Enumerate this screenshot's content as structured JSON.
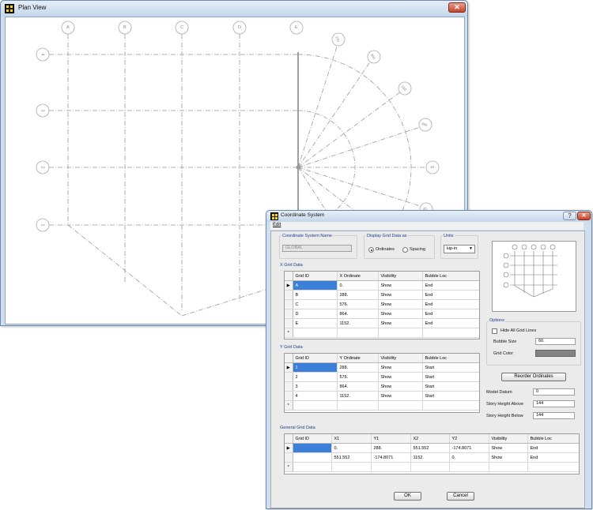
{
  "plan_window": {
    "title": "Plan View",
    "close_label": "✕",
    "x_bubbles": [
      "A",
      "B",
      "C",
      "D",
      "E"
    ],
    "y_bubbles": [
      "4",
      "3",
      "2",
      "1"
    ],
    "radial_bubbles": [
      "270",
      "300",
      "330",
      "360",
      "15",
      "45"
    ]
  },
  "dialog": {
    "title": "Coordinate System",
    "help_label": "?",
    "close_label": "✕",
    "menu": {
      "edit": "Edit"
    },
    "coord_system": {
      "label": "Coordinate System Name",
      "value": "GLOBAL"
    },
    "display_grid": {
      "label": "Display Grid Data as",
      "ordinates_label": "Ordinates",
      "spacing_label": "Spacing",
      "selected": "Ordinates"
    },
    "units": {
      "label": "Units",
      "value": "kip-in"
    },
    "x_grid": {
      "label": "X Grid Data",
      "columns": [
        "Grid ID",
        "X Ordinate",
        "Visibility",
        "Bubble Loc"
      ],
      "rows": [
        [
          "A",
          "0.",
          "Show",
          "End"
        ],
        [
          "B",
          "288.",
          "Show",
          "End"
        ],
        [
          "C",
          "576.",
          "Show",
          "End"
        ],
        [
          "D",
          "864.",
          "Show",
          "End"
        ],
        [
          "E",
          "1152.",
          "Show",
          "End"
        ]
      ]
    },
    "y_grid": {
      "label": "Y Grid Data",
      "columns": [
        "Grid ID",
        "Y Ordinate",
        "Visibility",
        "Bubble Loc"
      ],
      "rows": [
        [
          "1",
          "288.",
          "Show",
          "Start"
        ],
        [
          "2",
          "576.",
          "Show",
          "Start"
        ],
        [
          "3",
          "864.",
          "Show",
          "Start"
        ],
        [
          "4",
          "1152.",
          "Show",
          "Start"
        ]
      ]
    },
    "general_grid": {
      "label": "General Grid Data",
      "columns": [
        "Grid ID",
        "X1",
        "Y1",
        "X2",
        "Y2",
        "Visibility",
        "Bubble Loc"
      ],
      "rows": [
        [
          "",
          "0.",
          "288.",
          "551.552",
          "-174.8071",
          "Show",
          "End"
        ],
        [
          "",
          "551.552",
          "-174.8071",
          "1152.",
          "0.",
          "Show",
          "End"
        ]
      ]
    },
    "options": {
      "label": "Options",
      "hide_all_label": "Hide All Grid Lines",
      "bubble_size_label": "Bubble Size",
      "bubble_size_value": "60.",
      "grid_color_label": "Grid Color",
      "grid_color": "#828282"
    },
    "reorder_label": "Reorder Ordinates",
    "model_datum": {
      "label": "Model Datum",
      "value": "0"
    },
    "story_above": {
      "label": "Story Height Above",
      "value": "144"
    },
    "story_below": {
      "label": "Story Height Below",
      "value": "144"
    },
    "ok_label": "OK",
    "cancel_label": "Cancel",
    "new_row_marker": "*",
    "current_row_marker": "▶"
  },
  "colors": {
    "selection": "#3b7fd9",
    "group_label": "#1a3d8f"
  }
}
